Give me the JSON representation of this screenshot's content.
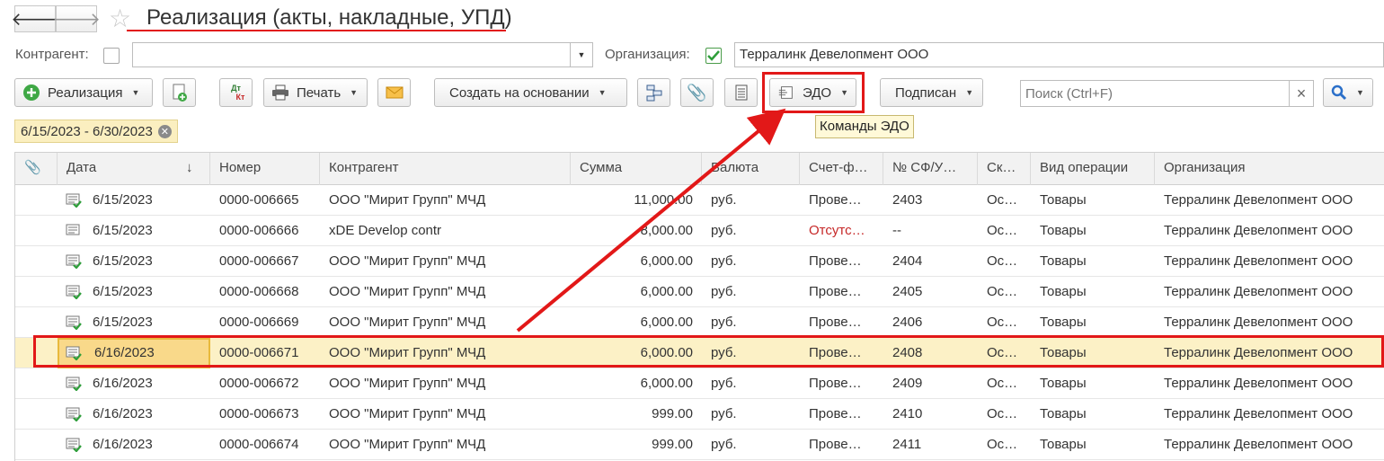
{
  "window": {
    "title": "Реализация (акты, накладные, УПД)",
    "back_glyph": "🡐",
    "forward_glyph": "🡒"
  },
  "filters": {
    "counterparty_label": "Контрагент:",
    "counterparty_value": "",
    "organization_label": "Организация:",
    "organization_value": "Терралинк Девелопмент ООО",
    "date_range": "6/15/2023 - 6/30/2023"
  },
  "toolbar": {
    "realization_label": "Реализация",
    "dtkt_label_top": "Дт",
    "dtkt_label_bottom": "Кт",
    "print_label": "Печать",
    "create_based_label": "Создать на основании",
    "edo_label": "ЭДО",
    "signed_label": "Подписан",
    "search_placeholder": "Поиск (Ctrl+F)",
    "search_clear": "×"
  },
  "tooltip": {
    "text": "Команды ЭДО"
  },
  "table": {
    "columns": [
      "Дата",
      "Номер",
      "Контрагент",
      "Сумма",
      "Валюта",
      "Счет-ф…",
      "№ СФ/У…",
      "Ск…",
      "Вид операции",
      "Организация"
    ],
    "sort_glyph": "↓",
    "rows": [
      {
        "date": "6/15/2023",
        "number": "0000-006665",
        "counterparty": "ООО \"Мирит Групп\" МЧД",
        "sum": "11,000.00",
        "currency": "руб.",
        "invoice": "Прове…",
        "invoice_red": false,
        "sf": "2403",
        "sk": "Ос…",
        "operation": "Товары",
        "org": "Терралинк Девелопмент ООО",
        "posted": true,
        "selected": false
      },
      {
        "date": "6/15/2023",
        "number": "0000-006666",
        "counterparty": "xDE Develop contr",
        "sum": "8,000.00",
        "currency": "руб.",
        "invoice": "Отсутс…",
        "invoice_red": true,
        "sf": "--",
        "sk": "Ос…",
        "operation": "Товары",
        "org": "Терралинк Девелопмент ООО",
        "posted": false,
        "selected": false
      },
      {
        "date": "6/15/2023",
        "number": "0000-006667",
        "counterparty": "ООО \"Мирит Групп\" МЧД",
        "sum": "6,000.00",
        "currency": "руб.",
        "invoice": "Прове…",
        "invoice_red": false,
        "sf": "2404",
        "sk": "Ос…",
        "operation": "Товары",
        "org": "Терралинк Девелопмент ООО",
        "posted": true,
        "selected": false
      },
      {
        "date": "6/15/2023",
        "number": "0000-006668",
        "counterparty": "ООО \"Мирит Групп\" МЧД",
        "sum": "6,000.00",
        "currency": "руб.",
        "invoice": "Прове…",
        "invoice_red": false,
        "sf": "2405",
        "sk": "Ос…",
        "operation": "Товары",
        "org": "Терралинк Девелопмент ООО",
        "posted": true,
        "selected": false
      },
      {
        "date": "6/15/2023",
        "number": "0000-006669",
        "counterparty": "ООО \"Мирит Групп\" МЧД",
        "sum": "6,000.00",
        "currency": "руб.",
        "invoice": "Прове…",
        "invoice_red": false,
        "sf": "2406",
        "sk": "Ос…",
        "operation": "Товары",
        "org": "Терралинк Девелопмент ООО",
        "posted": true,
        "selected": false
      },
      {
        "date": "6/16/2023",
        "number": "0000-006671",
        "counterparty": "ООО \"Мирит Групп\" МЧД",
        "sum": "6,000.00",
        "currency": "руб.",
        "invoice": "Прове…",
        "invoice_red": false,
        "sf": "2408",
        "sk": "Ос…",
        "operation": "Товары",
        "org": "Терралинк Девелопмент ООО",
        "posted": true,
        "selected": true
      },
      {
        "date": "6/16/2023",
        "number": "0000-006672",
        "counterparty": "ООО \"Мирит Групп\" МЧД",
        "sum": "6,000.00",
        "currency": "руб.",
        "invoice": "Прове…",
        "invoice_red": false,
        "sf": "2409",
        "sk": "Ос…",
        "operation": "Товары",
        "org": "Терралинк Девелопмент ООО",
        "posted": true,
        "selected": false
      },
      {
        "date": "6/16/2023",
        "number": "0000-006673",
        "counterparty": "ООО \"Мирит Групп\" МЧД",
        "sum": "999.00",
        "currency": "руб.",
        "invoice": "Прове…",
        "invoice_red": false,
        "sf": "2410",
        "sk": "Ос…",
        "operation": "Товары",
        "org": "Терралинк Девелопмент ООО",
        "posted": true,
        "selected": false
      },
      {
        "date": "6/16/2023",
        "number": "0000-006674",
        "counterparty": "ООО \"Мирит Групп\" МЧД",
        "sum": "999.00",
        "currency": "руб.",
        "invoice": "Прове…",
        "invoice_red": false,
        "sf": "2411",
        "sk": "Ос…",
        "operation": "Товары",
        "org": "Терралинк Девелопмент ООО",
        "posted": true,
        "selected": false
      }
    ]
  },
  "icons": {
    "add": "plus-circle-icon",
    "copy": "copy-document-icon",
    "print": "printer-icon",
    "mail": "envelope-icon",
    "structure": "structure-icon",
    "attach": "paperclip-icon",
    "list": "list-icon",
    "edo": "edo-icon",
    "search": "magnifier-icon",
    "favorite": "star-icon",
    "posted_doc": "posted-document-icon",
    "unposted_doc": "document-icon"
  },
  "colors": {
    "highlight_red": "#e21818",
    "selected_row": "#fcf1c6",
    "filter_tag": "#fbefc0",
    "add_green": "#3fa845",
    "check_green": "#2e9e3a",
    "search_blue": "#2a6fc9"
  }
}
